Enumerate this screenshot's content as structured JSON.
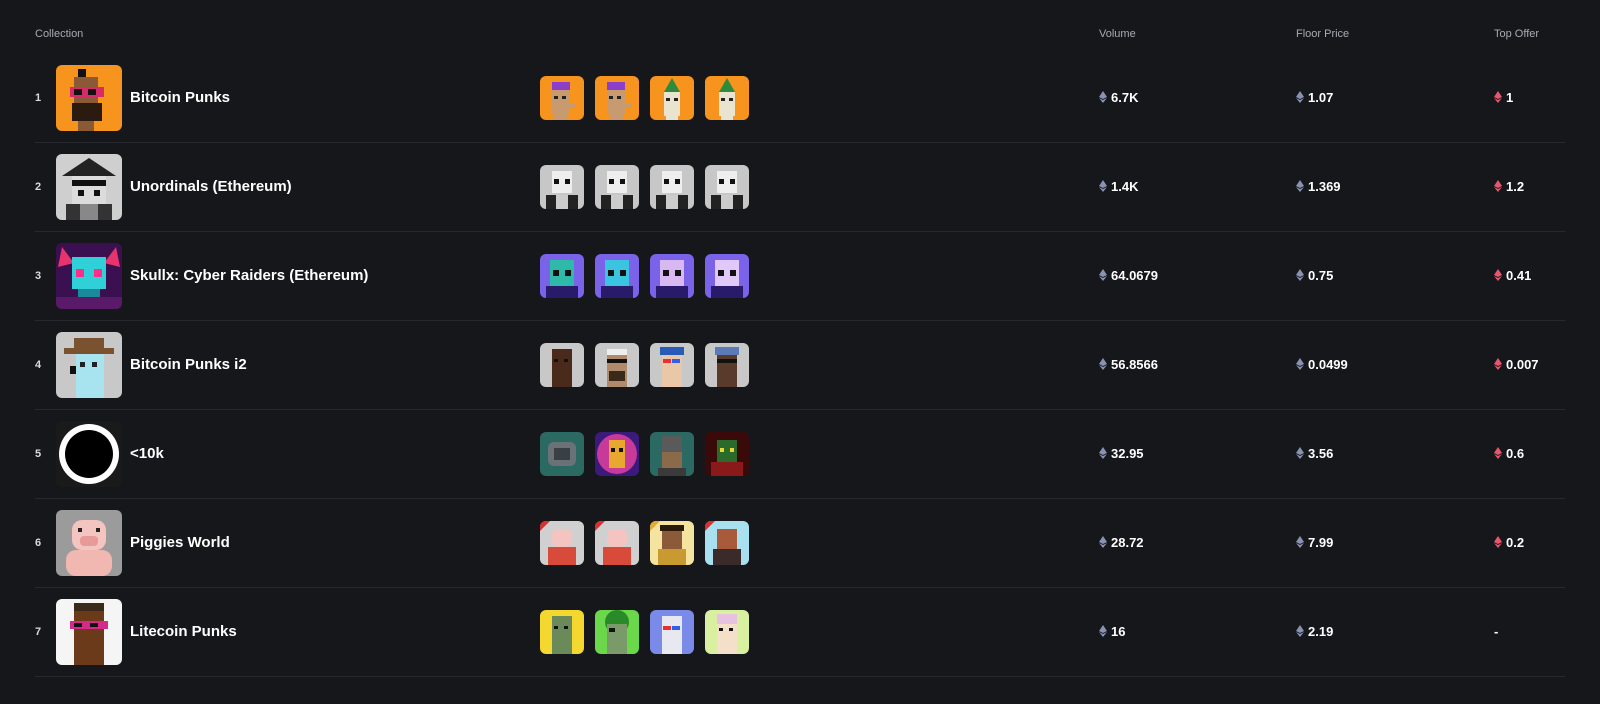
{
  "header": {
    "collection": "Collection",
    "volume": "Volume",
    "floor": "Floor Price",
    "offer": "Top Offer"
  },
  "rows": [
    {
      "rank": "1",
      "name": "Bitcoin Punks",
      "volume": "6.7K",
      "floor": "1.07",
      "offer": "1",
      "logo_bg": "#f7941d"
    },
    {
      "rank": "2",
      "name": "Unordinals (Ethereum)",
      "volume": "1.4K",
      "floor": "1.369",
      "offer": "1.2",
      "logo_bg": "#cfcfcf"
    },
    {
      "rank": "3",
      "name": "Skullx: Cyber Raiders (Ethereum)",
      "volume": "64.0679",
      "floor": "0.75",
      "offer": "0.41",
      "logo_bg": "#2a1a4a"
    },
    {
      "rank": "4",
      "name": "Bitcoin Punks i2",
      "volume": "56.8566",
      "floor": "0.0499",
      "offer": "0.007",
      "logo_bg": "#c8c8c8"
    },
    {
      "rank": "5",
      "name": "<10k",
      "volume": "32.95",
      "floor": "3.56",
      "offer": "0.6",
      "logo_bg": "#1a1a1a"
    },
    {
      "rank": "6",
      "name": "Piggies World",
      "volume": "28.72",
      "floor": "7.99",
      "offer": "0.2",
      "logo_bg": "#9b9b9b"
    },
    {
      "rank": "7",
      "name": "Litecoin Punks",
      "volume": "16",
      "floor": "2.19",
      "offer": "-",
      "logo_bg": "#f5f5f5"
    }
  ],
  "colors": {
    "eth_icon": "#8a92b2",
    "offer_icon": "#e8556d",
    "background": "#16171a",
    "divider": "#26282d"
  },
  "icons": {
    "volume": "eth-diamond-icon",
    "floor": "eth-diamond-icon",
    "offer": "eth-diamond-red-icon"
  }
}
